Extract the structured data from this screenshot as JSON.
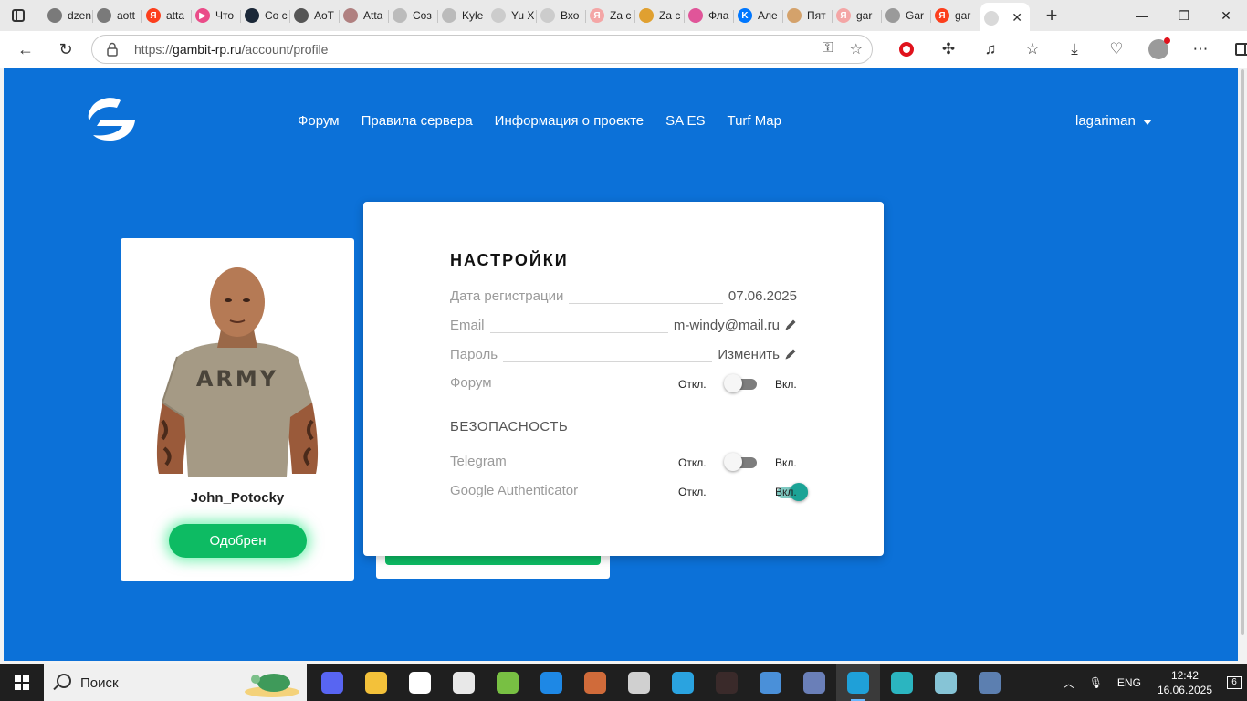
{
  "browser": {
    "tabs": [
      {
        "label": "dzen",
        "color": "#7a7a7a",
        "glyph": ""
      },
      {
        "label": "aott",
        "color": "#7a7a7a",
        "glyph": ""
      },
      {
        "label": "atta",
        "color": "#fc3f1d",
        "glyph": "Я"
      },
      {
        "label": "Что",
        "color": "#ea4c89",
        "glyph": "▶"
      },
      {
        "label": "Co c",
        "color": "#1b2838",
        "glyph": ""
      },
      {
        "label": "AoT",
        "color": "#555555",
        "glyph": ""
      },
      {
        "label": "Atta",
        "color": "#b08080",
        "glyph": ""
      },
      {
        "label": "Coз",
        "color": "#bbbbbb",
        "glyph": ""
      },
      {
        "label": "Kyle",
        "color": "#bbbbbb",
        "glyph": ""
      },
      {
        "label": "Yu X",
        "color": "#cccccc",
        "glyph": ""
      },
      {
        "label": "Вхо",
        "color": "#cccccc",
        "glyph": ""
      },
      {
        "label": "Za c",
        "color": "#f4a6a6",
        "glyph": "Я"
      },
      {
        "label": "Za c",
        "color": "#e0a030",
        "glyph": ""
      },
      {
        "label": "Фла",
        "color": "#e05599",
        "glyph": ""
      },
      {
        "label": "Але",
        "color": "#0077ff",
        "glyph": "K"
      },
      {
        "label": "Пят",
        "color": "#d4a26b",
        "glyph": ""
      },
      {
        "label": "gar",
        "color": "#f4a6a6",
        "glyph": "Я"
      },
      {
        "label": "Gar",
        "color": "#9a9a9a",
        "glyph": ""
      },
      {
        "label": "gar",
        "color": "#fc3f1d",
        "glyph": "Я"
      }
    ],
    "url_prefix": "https://",
    "url_host": "gambit-rp.ru",
    "url_path": "/account/profile"
  },
  "site": {
    "nav": [
      "Форум",
      "Правила сервера",
      "Информация о проекте",
      "SA ES",
      "Turf Map"
    ],
    "username": "lagariman"
  },
  "profile": {
    "player_name": "John_Potocky",
    "status": "Одобрен",
    "shirt_text": "ARMY"
  },
  "settings": {
    "title": "НАСТРОЙКИ",
    "reg_label": "Дата регистрации",
    "reg_value": "07.06.2025",
    "email_label": "Email",
    "email_value": "m-windy@mail.ru",
    "password_label": "Пароль",
    "password_value": "Изменить",
    "forum_label": "Форум",
    "off_label": "Откл.",
    "on_label": "Вкл.",
    "security_title": "БЕЗОПАСНОСТЬ",
    "telegram_label": "Telegram",
    "ga_label": "Google Authenticator"
  },
  "toggles": {
    "forum": false,
    "telegram": false,
    "google_authenticator": true
  },
  "taskbar": {
    "search_placeholder": "Поиск",
    "language": "ENG",
    "time": "12:42",
    "date": "16.06.2025",
    "notifications": "6",
    "apps": [
      {
        "name": "discord",
        "color": "#5865f2"
      },
      {
        "name": "explorer",
        "color": "#f3c13a"
      },
      {
        "name": "yandex-browser",
        "color": "#ffffff"
      },
      {
        "name": "notepad",
        "color": "#e8e8e8"
      },
      {
        "name": "utorrent",
        "color": "#78c043"
      },
      {
        "name": "app-blue",
        "color": "#1e88e5"
      },
      {
        "name": "m365",
        "color": "#d06b3a"
      },
      {
        "name": "settings",
        "color": "#d0d0d0"
      },
      {
        "name": "telegram",
        "color": "#2aa3e0"
      },
      {
        "name": "app-dark",
        "color": "#3a2a2a"
      },
      {
        "name": "app-paint",
        "color": "#4a90d9"
      },
      {
        "name": "app-image",
        "color": "#6a7fb8"
      },
      {
        "name": "edge",
        "color": "#1fa0d8"
      },
      {
        "name": "app-v",
        "color": "#2bb5c0"
      },
      {
        "name": "app-glass",
        "color": "#86c4d6"
      },
      {
        "name": "app-news",
        "color": "#5c7fb0"
      }
    ]
  }
}
